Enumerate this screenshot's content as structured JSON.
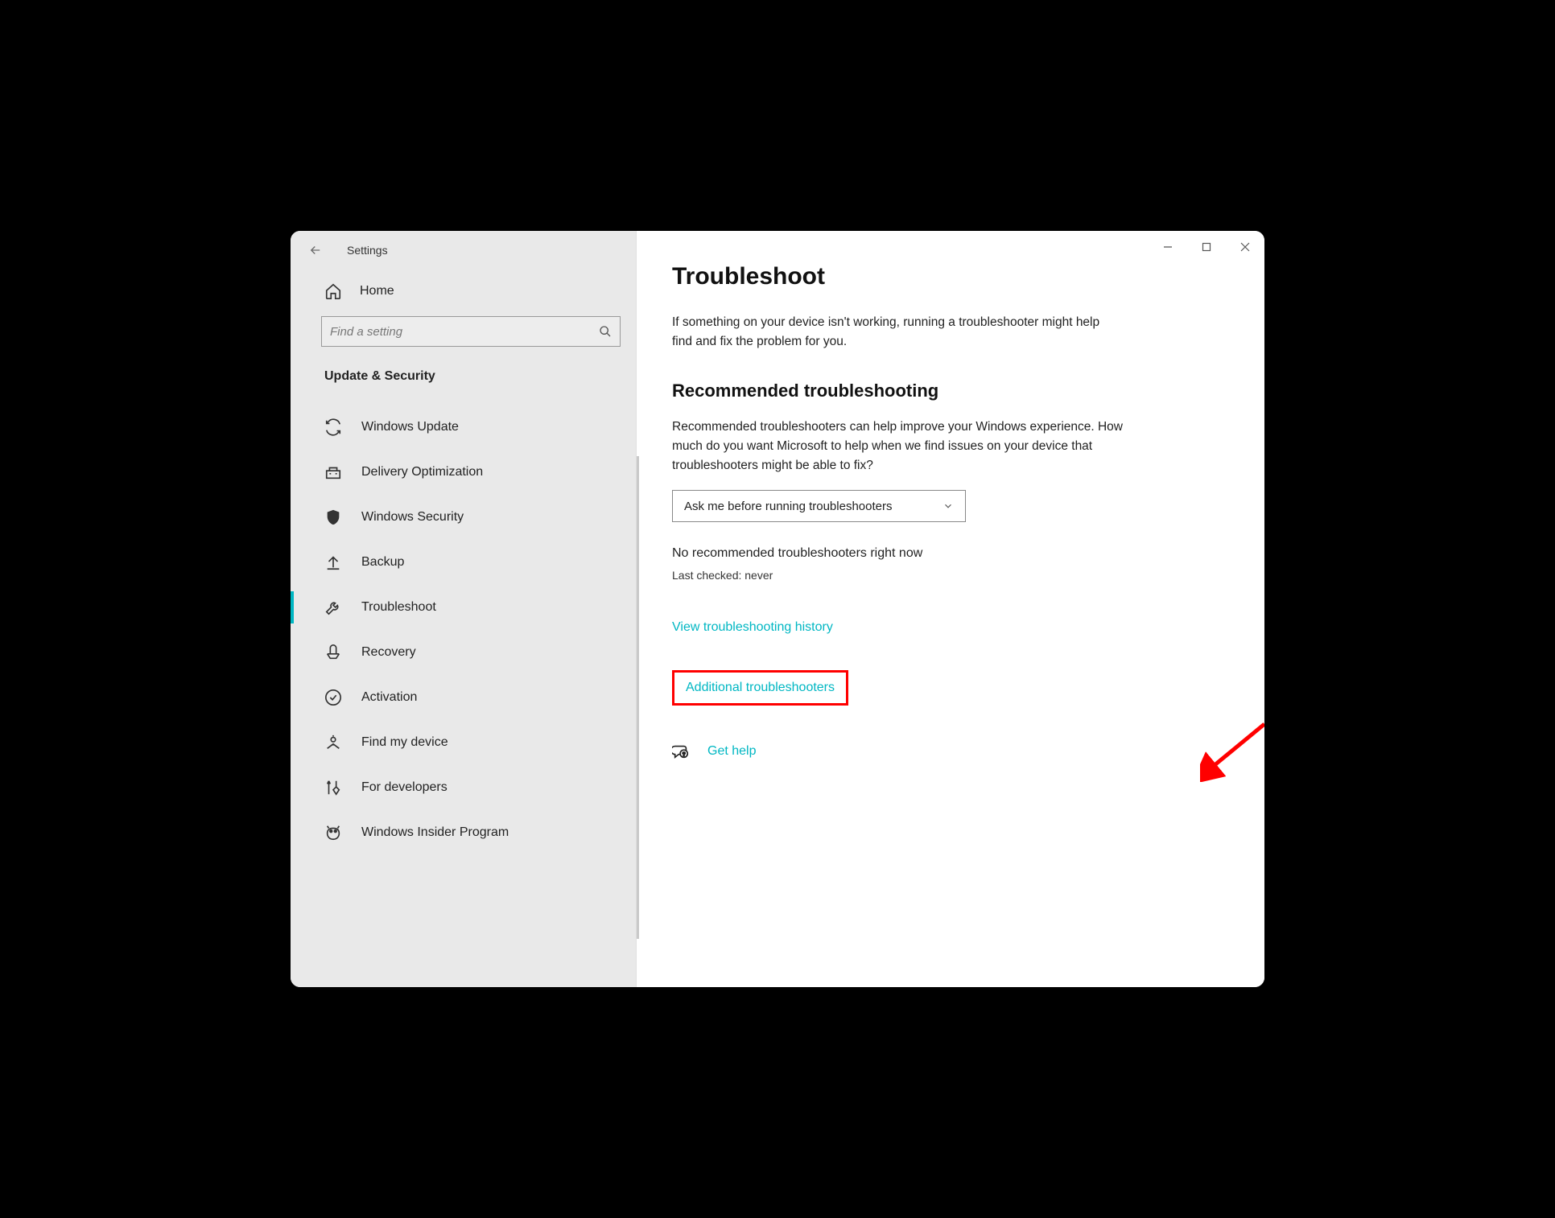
{
  "window": {
    "title": "Settings"
  },
  "sidebar": {
    "home": "Home",
    "search_placeholder": "Find a setting",
    "section": "Update & Security",
    "items": [
      {
        "label": "Windows Update"
      },
      {
        "label": "Delivery Optimization"
      },
      {
        "label": "Windows Security"
      },
      {
        "label": "Backup"
      },
      {
        "label": "Troubleshoot"
      },
      {
        "label": "Recovery"
      },
      {
        "label": "Activation"
      },
      {
        "label": "Find my device"
      },
      {
        "label": "For developers"
      },
      {
        "label": "Windows Insider Program"
      }
    ]
  },
  "main": {
    "title": "Troubleshoot",
    "intro": "If something on your device isn't working, running a troubleshooter might help find and fix the problem for you.",
    "rec_title": "Recommended troubleshooting",
    "rec_body": "Recommended troubleshooters can help improve your Windows experience. How much do you want Microsoft to help when we find issues on your device that troubleshooters might be able to fix?",
    "dropdown_value": "Ask me before running troubleshooters",
    "status": "No recommended troubleshooters right now",
    "last_checked": "Last checked: never",
    "link_history": "View troubleshooting history",
    "link_additional": "Additional troubleshooters",
    "link_help": "Get help"
  }
}
